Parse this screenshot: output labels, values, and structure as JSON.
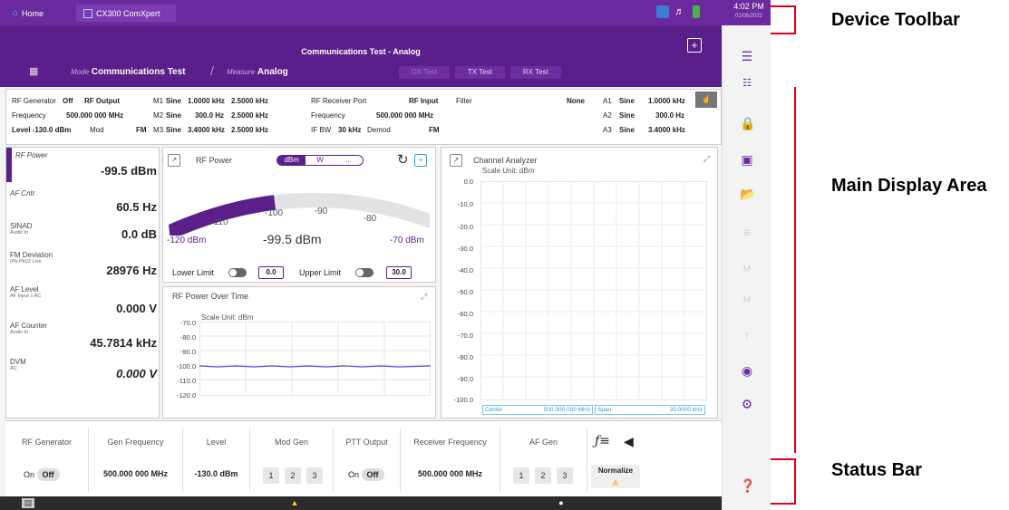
{
  "topbar": {
    "home": "Home",
    "app": "CX300 ComXpert",
    "time": "4:02 PM",
    "date": "01/06/2022"
  },
  "header": {
    "title": "Communications Test - Analog",
    "mode_key": "Mode",
    "mode": "Communications Test",
    "measure_key": "Measure",
    "measure": "Analog",
    "tabs": [
      "DX Test",
      "TX Test",
      "RX Test"
    ],
    "plus": "+"
  },
  "info": {
    "rf_generator_label": "RF Generator",
    "rf_generator": "Off",
    "rf_output": "RF Output",
    "frequency_label": "Frequency",
    "frequency": "500.000 000 MHz",
    "level": "Level -130.0 dBm",
    "mod_label": "Mod",
    "mod": "FM",
    "m_rows": [
      [
        "M1",
        "Sine",
        "1.0000 kHz",
        "2.5000 kHz"
      ],
      [
        "M2",
        "Sine",
        "300.0 Hz",
        "2.5000 kHz"
      ],
      [
        "M3",
        "Sine",
        "3.4000 kHz",
        "2.5000 kHz"
      ]
    ],
    "rx_port_label": "RF Receiver Port",
    "rx_port": "RF Input",
    "rx_freq_label": "Frequency",
    "rx_freq": "500.000 000 MHz",
    "ifbw_label": "IF BW",
    "ifbw": "30 kHz",
    "demod_label": "Demod",
    "demod": "FM",
    "filter_label": "Filter",
    "filter": "None",
    "a_rows": [
      [
        "A1",
        "Sine",
        "1.0000 kHz"
      ],
      [
        "A2",
        "Sine",
        "300.0 Hz"
      ],
      [
        "A3",
        "Sine",
        "3.4000 kHz"
      ]
    ]
  },
  "measurements": [
    {
      "label": "RF Power",
      "sub": "",
      "value": "-99.5 dBm"
    },
    {
      "label": "AF Cntr",
      "sub": "",
      "value": "60.5 Hz"
    },
    {
      "label": "SINAD",
      "sub": "Audio In",
      "value": "0.0 dB"
    },
    {
      "label": "FM Deviation",
      "sub": "(Pk-Pk)/2 Live",
      "value": "28976 Hz"
    },
    {
      "label": "AF Level",
      "sub": "AF Input 1 AC",
      "value": "0.000 V"
    },
    {
      "label": "AF Counter",
      "sub": "Audio In",
      "value": "45.7814 kHz"
    },
    {
      "label": "DVM",
      "sub": "AC",
      "value": "0.000 V"
    }
  ],
  "rf_power": {
    "title": "RF Power",
    "units": [
      "dBm",
      "W",
      "..."
    ],
    "scale": [
      "-110",
      "-100",
      "-90",
      "-80"
    ],
    "min": "-120 dBm",
    "max": "-70 dBm",
    "reading": "-99.5 dBm",
    "lower_limit_label": "Lower Limit",
    "lower_limit": "0.0",
    "upper_limit_label": "Upper Limit",
    "upper_limit": "30.0"
  },
  "over_time": {
    "title": "RF Power Over Time",
    "scale_unit": "Scale Unit: dBm",
    "ticks": [
      "-70.0",
      "-80.0",
      "-90.0",
      "-100.0",
      "-110.0",
      "-120.0"
    ]
  },
  "analyzer": {
    "title": "Channel Analyzer",
    "scale_unit": "Scale Unit: dBm",
    "ticks": [
      "0.0",
      "-10.0",
      "-20.0",
      "-30.0",
      "-40.0",
      "-50.0",
      "-60.0",
      "-70.0",
      "-80.0",
      "-90.0",
      "-100.0"
    ],
    "center_label": "Center",
    "center": "500.000 000 MHz",
    "span_label": "Span",
    "span": "20.0000 kHz"
  },
  "status": {
    "rf_generator": "RF Generator",
    "gen_frequency": "Gen Frequency",
    "gen_frequency_val": "500.000 000 MHz",
    "level": "Level",
    "level_val": "-130.0 dBm",
    "mod_gen": "Mod Gen",
    "ptt_output": "PTT Output",
    "receiver_frequency": "Receiver Frequency",
    "receiver_frequency_val": "500.000 000 MHz",
    "af_gen": "AF Gen",
    "on": "On",
    "off": "Off",
    "b1": "1",
    "b2": "2",
    "b3": "3",
    "normalize": "Normalize"
  },
  "callouts": {
    "toolbar": "Device Toolbar",
    "main": "Main Display Area",
    "status": "Status Bar"
  },
  "colors": {
    "brand": "#6b2a9e",
    "header": "#5a1f8a",
    "callout": "#e3001b"
  }
}
